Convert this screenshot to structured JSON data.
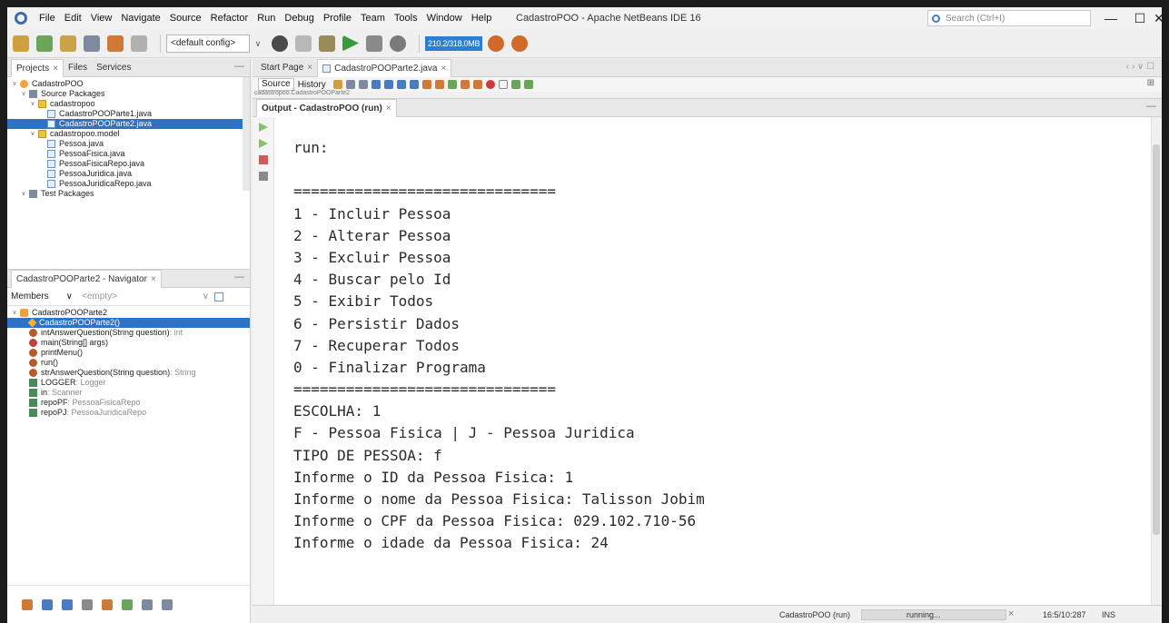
{
  "window": {
    "title": "CadastroPOO - Apache NetBeans IDE 16",
    "search_placeholder": "Search (Ctrl+I)",
    "buttons": [
      "—",
      "☐",
      "✕"
    ]
  },
  "menu": [
    "File",
    "Edit",
    "View",
    "Navigate",
    "Source",
    "Refactor",
    "Run",
    "Debug",
    "Profile",
    "Team",
    "Tools",
    "Window",
    "Help"
  ],
  "toolbar": {
    "config": "<default config>",
    "memory": "210.2/318.0MB"
  },
  "projects_panel": {
    "tabs": [
      "Projects",
      "Files",
      "Services"
    ],
    "tree": [
      {
        "label": "CadastroPOO",
        "indent": 0,
        "icon": "project-icon"
      },
      {
        "label": "Source Packages",
        "indent": 1,
        "icon": "source-packages-icon"
      },
      {
        "label": "cadastropoo",
        "indent": 2,
        "icon": "package-icon"
      },
      {
        "label": "CadastroPOOParte1.java",
        "indent": 3,
        "icon": "java-file-icon"
      },
      {
        "label": "CadastroPOOParte2.java",
        "indent": 3,
        "icon": "java-file-icon",
        "selected": true
      },
      {
        "label": "cadastropoo.model",
        "indent": 2,
        "icon": "package-icon"
      },
      {
        "label": "Pessoa.java",
        "indent": 3,
        "icon": "java-file-icon"
      },
      {
        "label": "PessoaFisica.java",
        "indent": 3,
        "icon": "java-file-icon"
      },
      {
        "label": "PessoaFisicaRepo.java",
        "indent": 3,
        "icon": "java-file-icon"
      },
      {
        "label": "PessoaJuridica.java",
        "indent": 3,
        "icon": "java-file-icon"
      },
      {
        "label": "PessoaJuridicaRepo.java",
        "indent": 3,
        "icon": "java-file-icon"
      },
      {
        "label": "Test Packages",
        "indent": 1,
        "icon": "test-packages-icon"
      }
    ]
  },
  "navigator_panel": {
    "title": "CadastroPOOParte2 - Navigator",
    "filter_label": "Members",
    "filter_value": "<empty>",
    "items": [
      {
        "label": "CadastroPOOParte2",
        "hint": "",
        "icon": "class-icon",
        "indent": 0
      },
      {
        "label": "CadastroPOOParte2()",
        "hint": "",
        "icon": "constructor-icon",
        "indent": 1,
        "selected": true
      },
      {
        "label": "intAnswerQuestion(String question)",
        "hint": " : int",
        "icon": "method-icon",
        "indent": 1
      },
      {
        "label": "main(String[] args)",
        "hint": "",
        "icon": "static-method-icon",
        "indent": 1
      },
      {
        "label": "printMenu()",
        "hint": "",
        "icon": "method-icon",
        "indent": 1
      },
      {
        "label": "run()",
        "hint": "",
        "icon": "method-icon",
        "indent": 1
      },
      {
        "label": "strAnswerQuestion(String question)",
        "hint": " : String",
        "icon": "method-icon",
        "indent": 1
      },
      {
        "label": "LOGGER",
        "hint": " : Logger",
        "icon": "field-icon",
        "indent": 1
      },
      {
        "label": "in",
        "hint": " : Scanner",
        "icon": "field-icon",
        "indent": 1
      },
      {
        "label": "repoPF",
        "hint": " : PessoaFisicaRepo",
        "icon": "field-icon",
        "indent": 1
      },
      {
        "label": "repoPJ",
        "hint": " : PessoaJuridicaRepo",
        "icon": "field-icon",
        "indent": 1
      }
    ]
  },
  "editor": {
    "tabs": [
      "Start Page",
      "CadastroPOOParte2.java"
    ],
    "source_tab": "Source",
    "history_tab": "History",
    "breadcrumb": "cadastropoo.CadastroPOOParte2"
  },
  "output": {
    "tab": "Output - CadastroPOO (run)",
    "lines": [
      "run:",
      "",
      "==============================",
      "1 - Incluir Pessoa",
      "2 - Alterar Pessoa",
      "3 - Excluir Pessoa",
      "4 - Buscar pelo Id",
      "5 - Exibir Todos",
      "6 - Persistir Dados",
      "7 - Recuperar Todos",
      "0 - Finalizar Programa",
      "==============================",
      "ESCOLHA: 1",
      "F - Pessoa Fisica | J - Pessoa Juridica",
      "TIPO DE PESSOA: f",
      "Informe o ID da Pessoa Fisica: 1",
      "Informe o nome da Pessoa Fisica: Talisson Jobim",
      "Informe o CPF da Pessoa Fisica: 029.102.710-56",
      "Informe o idade da Pessoa Fisica: 24",
      "",
      "",
      "==============================",
      "1 - Incluir Pessoa"
    ]
  },
  "status": {
    "task": "CadastroPOO (run)",
    "progress_label": "running...",
    "position": "16:5/10:287",
    "mode": "INS"
  }
}
